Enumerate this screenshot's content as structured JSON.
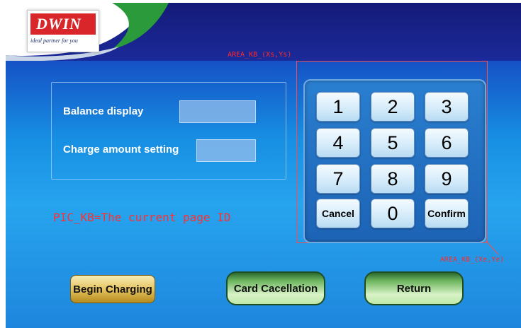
{
  "logo": {
    "brand": "DWIN",
    "tagline": "ideal partner for you"
  },
  "annotations": {
    "area_start": "AREA_KB_(Xs,Ys)",
    "area_end": "AREA_KB_(Xe,Ye)",
    "pic_kb": "PIC_KB=The current page ID"
  },
  "info": {
    "balance_label": "Balance display",
    "charge_label": "Charge amount setting",
    "balance_value": "",
    "charge_value": ""
  },
  "keypad": {
    "keys": [
      "1",
      "2",
      "3",
      "4",
      "5",
      "6",
      "7",
      "8",
      "9",
      "Cancel",
      "0",
      "Confirm"
    ]
  },
  "actions": {
    "begin": "Begin Charging",
    "card_cancel": "Card Cacellation",
    "return": "Return"
  },
  "colors": {
    "annotation": "#ff2a2a",
    "accent": "#1b2b7a"
  }
}
